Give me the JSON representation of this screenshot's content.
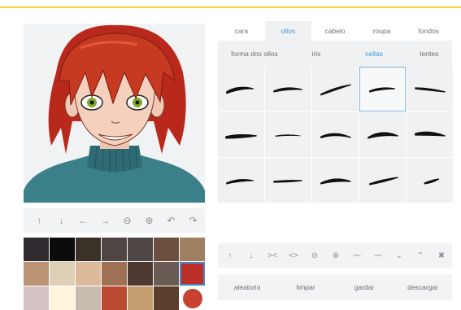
{
  "accent_color": "#3a9ad9",
  "top_line_color": "#f0d23c",
  "tabs": [
    {
      "label": "cara",
      "active": false
    },
    {
      "label": "ollos",
      "active": true
    },
    {
      "label": "cabelo",
      "active": false
    },
    {
      "label": "roupa",
      "active": false
    },
    {
      "label": "fondos",
      "active": false
    }
  ],
  "subtabs": [
    {
      "label": "forma dos ollos",
      "active": false
    },
    {
      "label": "iris",
      "active": false
    },
    {
      "label": "cellas",
      "active": true
    },
    {
      "label": "lentes",
      "active": false
    }
  ],
  "eyebrow_grid": {
    "columns": 5,
    "rows": 3,
    "selected_index": 3
  },
  "left_arrow_controls": [
    {
      "name": "move-up",
      "glyph": "↑"
    },
    {
      "name": "move-down",
      "glyph": "↓"
    },
    {
      "name": "move-left",
      "glyph": "←"
    },
    {
      "name": "move-right",
      "glyph": "→"
    },
    {
      "name": "zoom-out",
      "glyph": "⊖"
    },
    {
      "name": "zoom-in",
      "glyph": "⊕"
    },
    {
      "name": "rotate-left",
      "glyph": "↶"
    },
    {
      "name": "rotate-right",
      "glyph": "↷"
    }
  ],
  "right_arrow_controls": [
    {
      "name": "move-up",
      "glyph": "↑"
    },
    {
      "name": "move-down",
      "glyph": "↓"
    },
    {
      "name": "move-closer",
      "glyph": "><"
    },
    {
      "name": "move-apart",
      "glyph": "<>"
    },
    {
      "name": "shrink",
      "glyph": "⊖"
    },
    {
      "name": "grow",
      "glyph": "⊕"
    },
    {
      "name": "tilt-1",
      "glyph": "⁓"
    },
    {
      "name": "tilt-2",
      "glyph": "⁓"
    },
    {
      "name": "arch-down",
      "glyph": "⌄"
    },
    {
      "name": "arch-up",
      "glyph": "⌃"
    },
    {
      "name": "remove",
      "glyph": "✖"
    }
  ],
  "palette": [
    "#2f2b31",
    "#0c0c0c",
    "#3a3129",
    "#4f4644",
    "#4f4646",
    "#6b4e3e",
    "#a08063",
    "#bd9375",
    "#ddd0b6",
    "#dcb999",
    "#9e7054",
    "#4e3a30",
    "#6a5c54",
    "#bc2e28",
    "#d6c2c2",
    "#fff4dc",
    "#c8bcb0",
    "#bc4a33",
    "#c59f72",
    "#5a3d2b",
    "#c8402e"
  ],
  "palette_selected_index": 13,
  "palette_circle_index": 20,
  "actions": [
    {
      "label": "aleatorio"
    },
    {
      "label": "limpar"
    },
    {
      "label": "gardar"
    },
    {
      "label": "descargar"
    }
  ]
}
